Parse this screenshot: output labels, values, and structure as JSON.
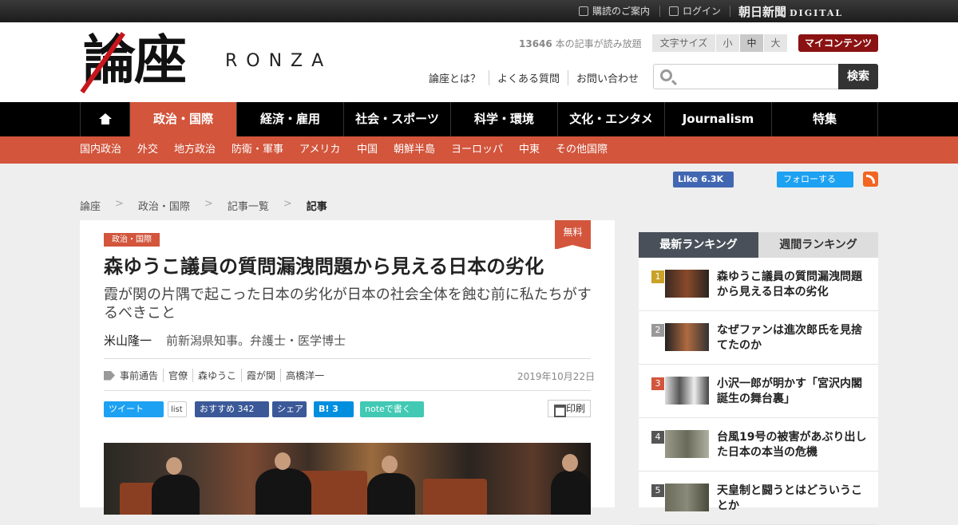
{
  "topbar": {
    "guide": "購読のご案内",
    "login": "ログイン",
    "brand": "朝日新聞",
    "brand_digital": "DIGITAL"
  },
  "header": {
    "logo_kanji": "論座",
    "logo_latin": "RONZA",
    "count_number": "13646",
    "count_text": "本の記事が読み放題",
    "font_size_label": "文字サイズ",
    "font_sizes": [
      "小",
      "中",
      "大"
    ],
    "my_contents": "マイコンテンツ",
    "links": [
      "論座とは？",
      "よくある質問",
      "お問い合わせ"
    ],
    "search_placeholder": "",
    "search_button": "検索"
  },
  "nav": {
    "items": [
      "政治・国際",
      "経済・雇用",
      "社会・スポーツ",
      "科学・環境",
      "文化・エンタメ",
      "Journalism",
      "特集"
    ],
    "active": "政治・国際"
  },
  "subnav": [
    "国内政治",
    "外交",
    "地方政治",
    "防衛・軍事",
    "アメリカ",
    "中国",
    "朝鮮半島",
    "ヨーロッパ",
    "中東",
    "その他国際"
  ],
  "social": {
    "fb_like": "Like 6.3K",
    "tw_follow": "フォローする"
  },
  "breadcrumb": [
    "論座",
    "政治・国際",
    "記事一覧",
    "記事"
  ],
  "article": {
    "category": "政治・国際",
    "free_badge": "無料",
    "title": "森ゆうこ議員の質問漏洩問題から見える日本の劣化",
    "subtitle": "霞が関の片隅で起こった日本の劣化が日本の社会全体を蝕む前に私たちがするべきこと",
    "author_name": "米山隆一",
    "author_desc": "前新潟県知事。弁護士・医学博士",
    "tags": [
      "事前通告",
      "官僚",
      "森ゆうこ",
      "霞が関",
      "高橋洋一"
    ],
    "date": "2019年10月22日",
    "share": {
      "tweet": "ツイート",
      "list": "list",
      "fb_recommend": "おすすめ 342",
      "fb_share": "シェア",
      "hatena": "B! 3",
      "note": "noteで書く",
      "print": "印刷"
    }
  },
  "ranking": {
    "tabs": [
      "最新ランキング",
      "週間ランキング"
    ],
    "items": [
      {
        "rank": "1",
        "title": "森ゆうこ議員の質問漏洩問題から見える日本の劣化",
        "color": "#c9a227"
      },
      {
        "rank": "2",
        "title": "なぜファンは進次郎氏を見捨てたのか",
        "color": "#999999"
      },
      {
        "rank": "3",
        "title": "小沢一郎が明かす「宮沢内閣誕生の舞台裏」",
        "color": "#d2553c"
      },
      {
        "rank": "4",
        "title": "台風19号の被害があぶり出した日本の本当の危機",
        "color": "#555555"
      },
      {
        "rank": "5",
        "title": "天皇制と闘うとはどういうことか",
        "color": "#555555"
      }
    ]
  },
  "colors": {
    "accent": "#d2553c",
    "nav_bg": "#000000",
    "my_contents": "#8b1212"
  }
}
